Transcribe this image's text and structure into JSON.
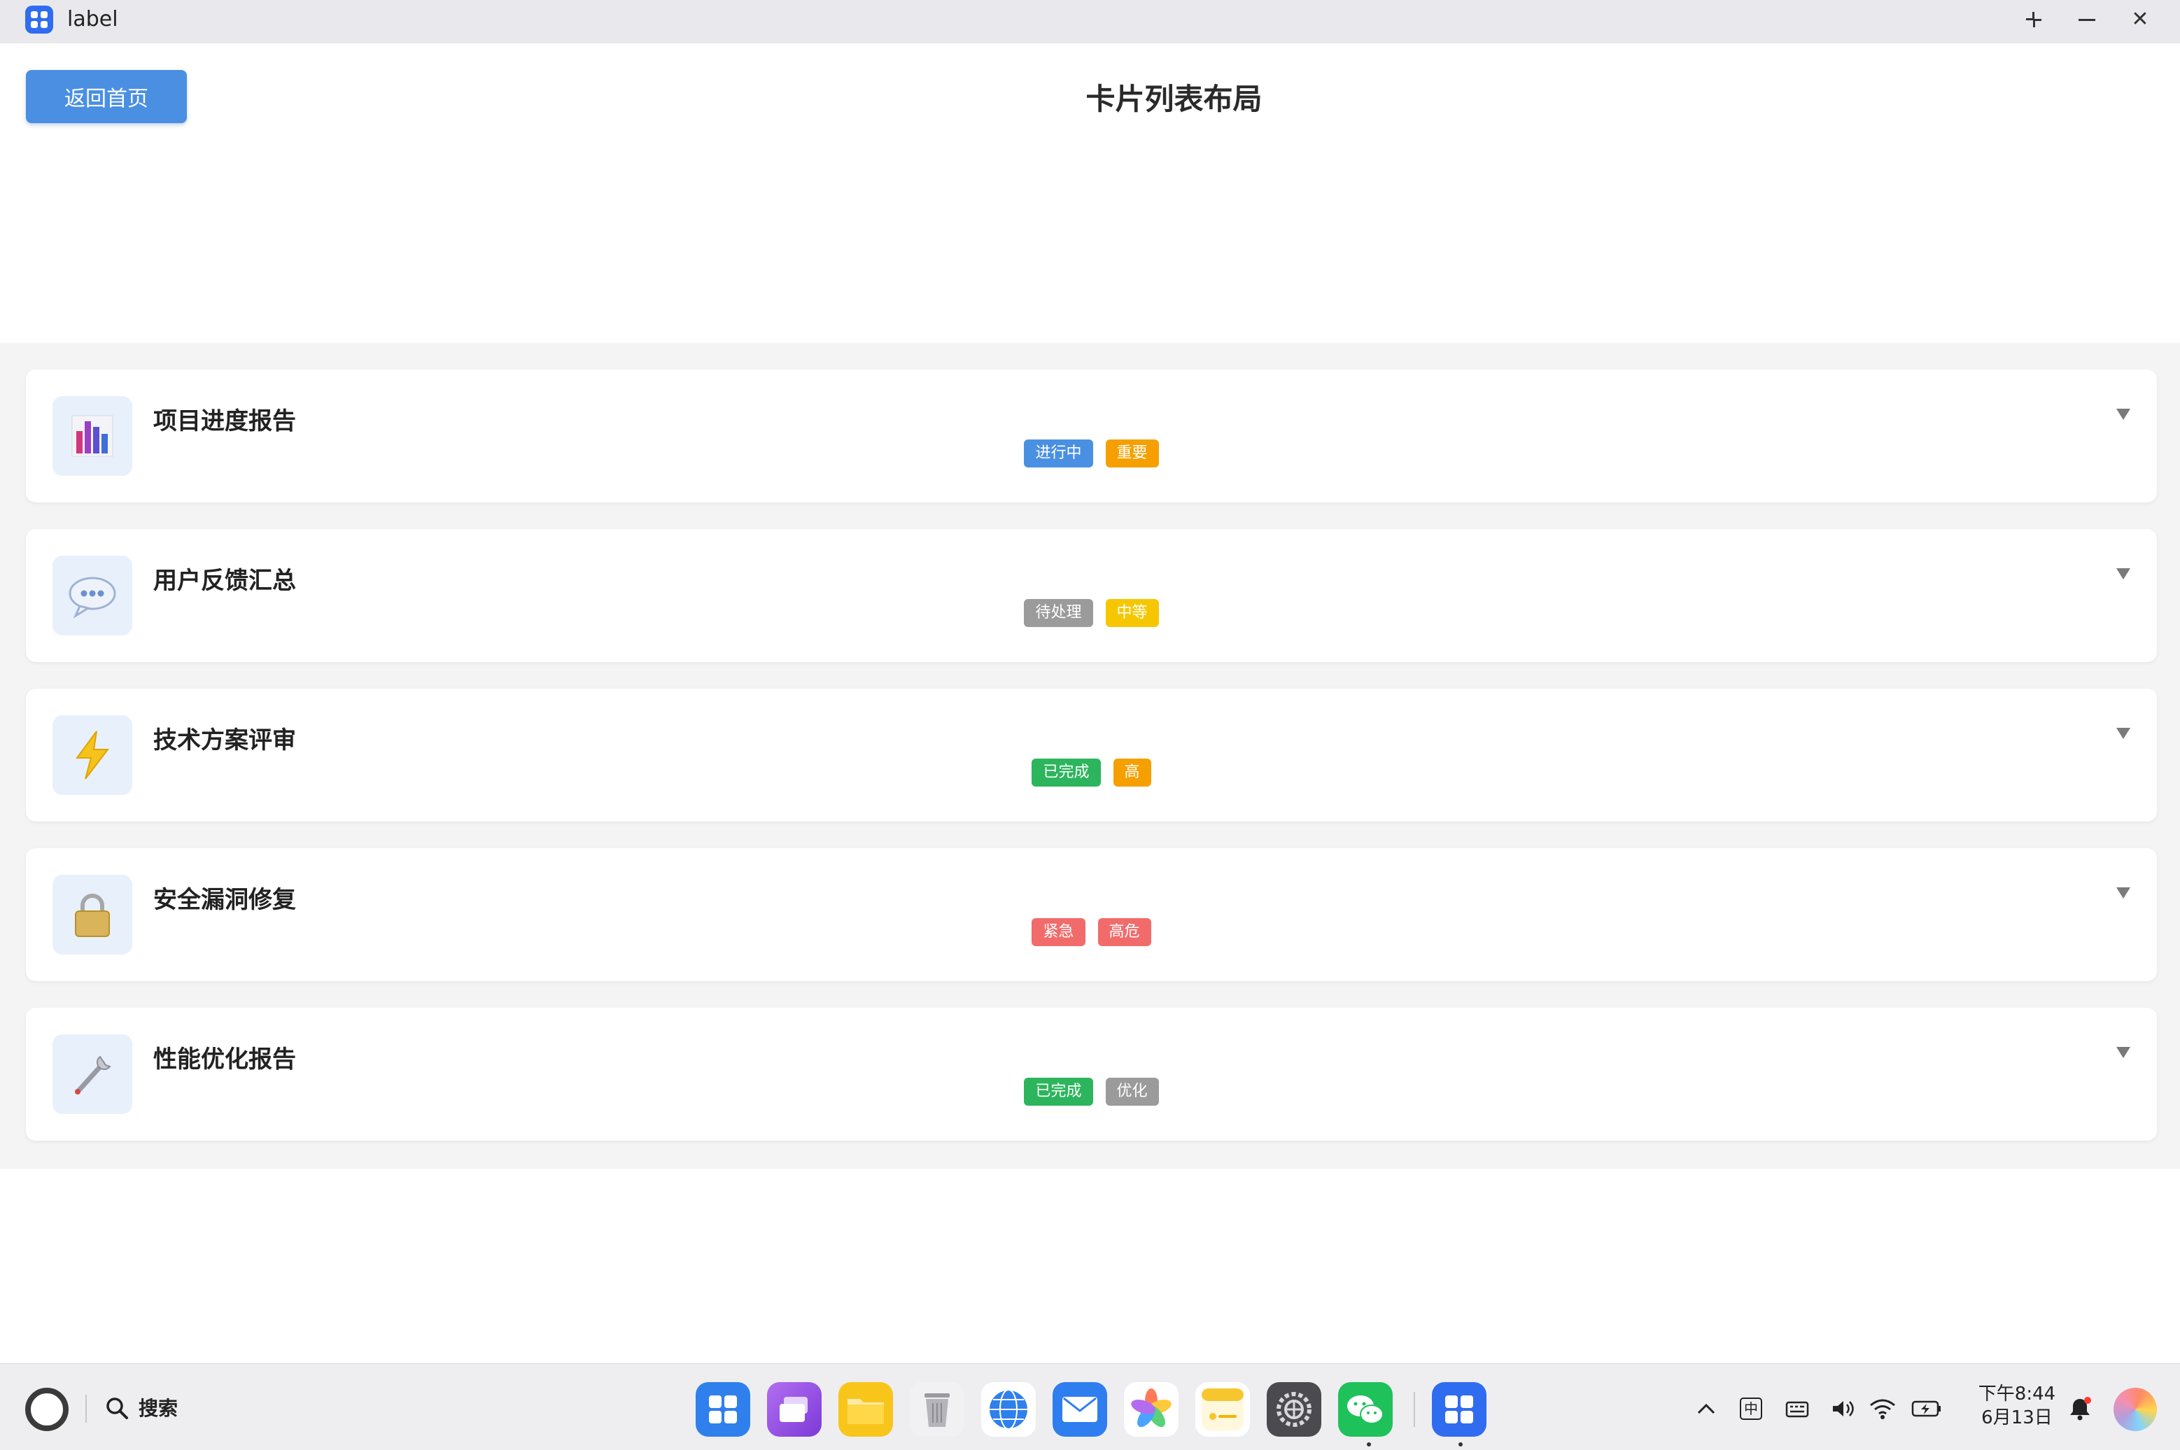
{
  "window": {
    "title": "label"
  },
  "header": {
    "back_label": "返回首页",
    "page_title": "卡片列表布局"
  },
  "cards": [
    {
      "title": "项目进度报告",
      "icon": "bar-chart-icon",
      "tags": [
        {
          "label": "进行中",
          "color": "#4a90e2"
        },
        {
          "label": "重要",
          "color": "#f5a000"
        }
      ]
    },
    {
      "title": "用户反馈汇总",
      "icon": "speech-bubble-icon",
      "tags": [
        {
          "label": "待处理",
          "color": "#9b9b9b"
        },
        {
          "label": "中等",
          "color": "#f6c700"
        }
      ]
    },
    {
      "title": "技术方案评审",
      "icon": "lightning-icon",
      "tags": [
        {
          "label": "已完成",
          "color": "#2db55d"
        },
        {
          "label": "高",
          "color": "#f5a000"
        }
      ]
    },
    {
      "title": "安全漏洞修复",
      "icon": "lock-icon",
      "tags": [
        {
          "label": "紧急",
          "color": "#f26b6b"
        },
        {
          "label": "高危",
          "color": "#f26b6b"
        }
      ]
    },
    {
      "title": "性能优化报告",
      "icon": "wrench-icon",
      "tags": [
        {
          "label": "已完成",
          "color": "#2db55d"
        },
        {
          "label": "优化",
          "color": "#9b9b9b"
        }
      ]
    }
  ],
  "taskbar": {
    "search_label": "搜索",
    "ime": "中",
    "clock_time": "下午8:44",
    "clock_date": "6月13日"
  }
}
